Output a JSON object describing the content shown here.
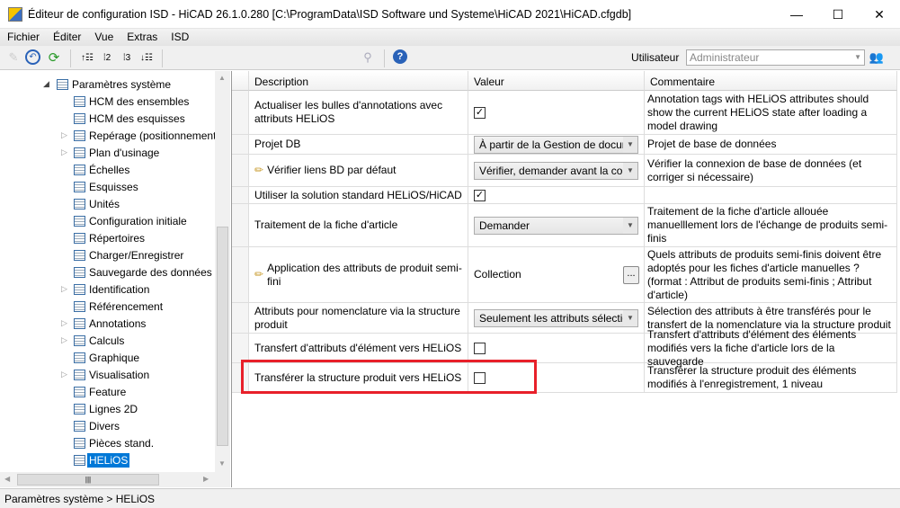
{
  "window": {
    "title": "Éditeur de configuration ISD  - HiCAD 26.1.0.280 [C:\\ProgramData\\ISD Software und Systeme\\HiCAD 2021\\HiCAD.cfgdb]",
    "minimize": "—",
    "maximize": "☐",
    "close": "✕"
  },
  "menu": [
    "Fichier",
    "Éditer",
    "Vue",
    "Extras",
    "ISD"
  ],
  "toolbar": {
    "user_label": "Utilisateur",
    "user_value": "Administrateur"
  },
  "tree": {
    "parent": "Paramètres système",
    "items": [
      {
        "label": "HCM des ensembles",
        "exp": false
      },
      {
        "label": "HCM des esquisses",
        "exp": false
      },
      {
        "label": "Repérage (positionnement)",
        "exp": true
      },
      {
        "label": "Plan d'usinage",
        "exp": true
      },
      {
        "label": "Échelles",
        "exp": false
      },
      {
        "label": "Esquisses",
        "exp": false
      },
      {
        "label": "Unités",
        "exp": false
      },
      {
        "label": "Configuration initiale",
        "exp": false
      },
      {
        "label": "Répertoires",
        "exp": false
      },
      {
        "label": "Charger/Enregistrer",
        "exp": false
      },
      {
        "label": "Sauvegarde des données",
        "exp": false
      },
      {
        "label": "Identification",
        "exp": true
      },
      {
        "label": "Référencement",
        "exp": false
      },
      {
        "label": "Annotations",
        "exp": true
      },
      {
        "label": "Calculs",
        "exp": true
      },
      {
        "label": "Graphique",
        "exp": false
      },
      {
        "label": "Visualisation",
        "exp": true
      },
      {
        "label": "Feature",
        "exp": false
      },
      {
        "label": "Lignes 2D",
        "exp": false
      },
      {
        "label": "Divers",
        "exp": false
      },
      {
        "label": "Pièces stand.",
        "exp": false
      },
      {
        "label": "HELiOS",
        "exp": false,
        "selected": true
      }
    ]
  },
  "grid": {
    "headers": [
      "Description",
      "Valeur",
      "Commentaire"
    ],
    "rows": [
      {
        "desc": "Actualiser les bulles d'annotations avec attributs HELiOS",
        "type": "check",
        "checked": true,
        "comment": "Annotation tags with HELiOS attributes should show the current HELiOS state after loading a model drawing"
      },
      {
        "desc": "Projet DB",
        "type": "combo",
        "value": "À partir de la Gestion de documents",
        "comment": "Projet de base de données"
      },
      {
        "desc": "Vérifier liens BD par défaut",
        "pencil": true,
        "type": "combo",
        "value": "Vérifier, demander avant la correction",
        "comment": "Vérifier la connexion de base de données (et corriger si nécessaire)"
      },
      {
        "desc": "Utiliser la solution standard HELiOS/HiCAD",
        "type": "check",
        "checked": true,
        "comment": ""
      },
      {
        "desc": "Traitement de la fiche d'article",
        "type": "combo",
        "value": "Demander",
        "comment": "Traitement de la fiche d'article allouée manuelllement lors de l'échange de produits semi-finis"
      },
      {
        "desc": "Application des attributs de produit semi-fini",
        "pencil": true,
        "type": "collection",
        "value": "Collection",
        "button": "...",
        "comment": "Quels attributs de produits semi-finis doivent être adoptés pour les fiches d'article manuelles ? (format : Attribut de produits semi-finis ; Attribut d'article)"
      },
      {
        "desc": "Attributs pour nomenclature via la structure produit",
        "type": "combo",
        "value": "Seulement les attributs sélectionnés",
        "comment": "Sélection des attributs à être transférés pour le transfert de la nomenclature via la structure produit"
      },
      {
        "desc": "Transfert d'attributs d'élément vers HELiOS",
        "type": "check",
        "checked": false,
        "comment": "Transfert d'attributs d'élément des éléments modifiés vers la fiche d'article lors de la sauvegarde"
      },
      {
        "desc": "Transférer la structure produit vers HELiOS",
        "type": "check",
        "checked": false,
        "comment": "Transférer la structure produit des éléments modifiés à l'enregistrement, 1 niveau"
      }
    ]
  },
  "status": "Paramètres système > HELiOS",
  "colors": {
    "selection": "#0078d7",
    "highlight": "#e8202a"
  }
}
